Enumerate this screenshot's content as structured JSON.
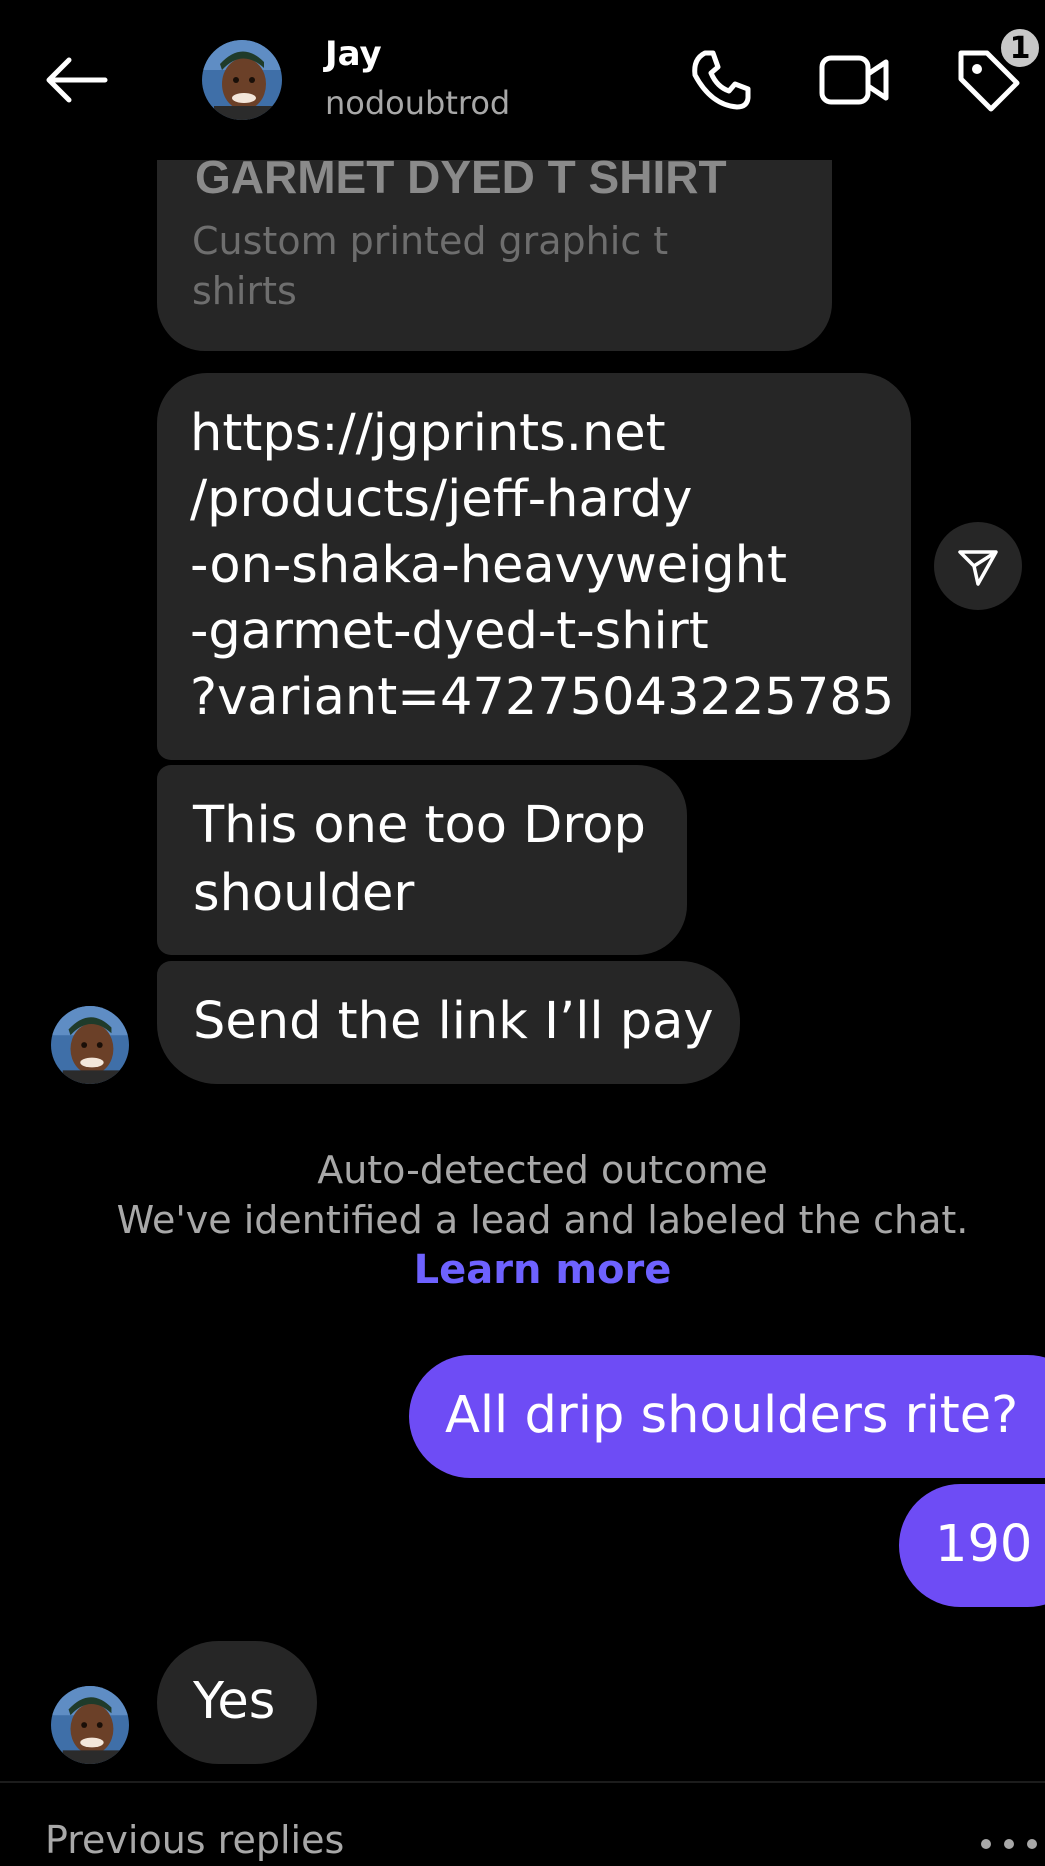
{
  "header": {
    "contact_name": "Jay",
    "contact_handle": "nodoubtrod",
    "tag_badge_count": "1"
  },
  "product_card": {
    "title": "GARMET DYED T SHIRT",
    "subtitle": "Custom printed graphic t shirts"
  },
  "messages": {
    "link": "https://jgprints.net\n/products/jeff-hardy\n-on-shaka-heavyweight\n-garmet-dyed-t-shirt\n?variant=47275043225785",
    "drop_shoulder": "This one too Drop\nshoulder",
    "send_link": "Send the link I’ll pay",
    "drip_question": "All drip shoulders rite?",
    "price": "190",
    "yes": "Yes"
  },
  "notice": {
    "title": "Auto-detected outcome",
    "body": "We've identified a lead and labeled the chat.",
    "link": "Learn more"
  },
  "footer": {
    "previous_replies": "Previous replies"
  },
  "colors": {
    "background": "#000000",
    "incoming_bubble": "#262626",
    "outgoing_bubble": "#6e4cf5",
    "link": "#6e62ff",
    "secondary_text": "#a8a8a8"
  },
  "icons": [
    "back-arrow-icon",
    "phone-icon",
    "video-camera-icon",
    "tag-icon",
    "send-share-icon",
    "more-dots-icon"
  ]
}
